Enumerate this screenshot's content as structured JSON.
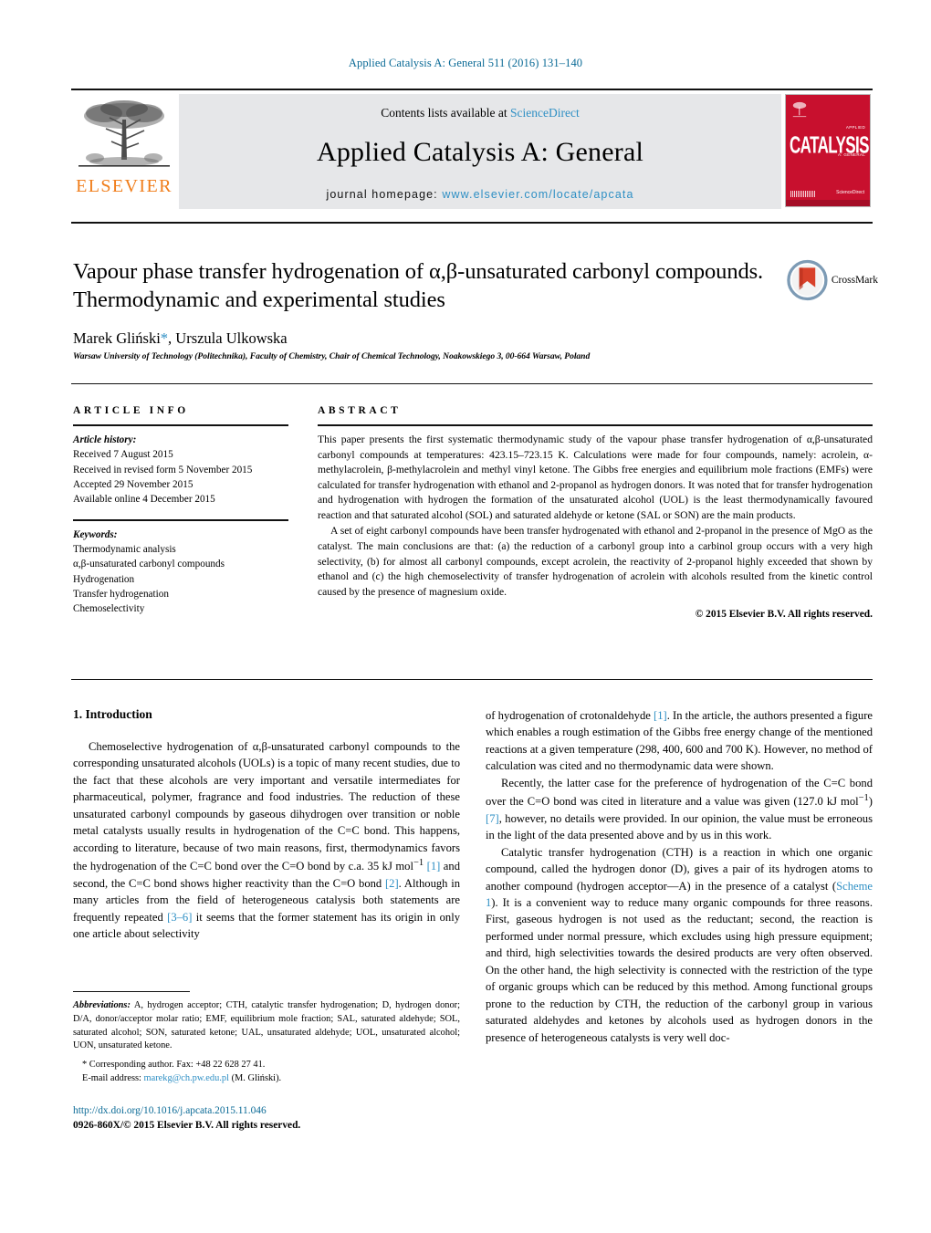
{
  "running_head": "Applied Catalysis A: General 511 (2016) 131–140",
  "masthead": {
    "elsevier_wordmark": "ELSEVIER",
    "contents_prefix": "Contents lists available at",
    "contents_link": "ScienceDirect",
    "journal_title": "Applied Catalysis A: General",
    "homepage_label": "journal homepage:",
    "homepage_url": "www.elsevier.com/locate/apcata",
    "cover": {
      "title": "CATALYSIS",
      "sup_top": "APPLIED",
      "sup_bottom": "A: GENERAL",
      "publisher": "Available online at\nScienceDirect"
    }
  },
  "article": {
    "title": "Vapour phase transfer hydrogenation of α,β-unsaturated carbonyl compounds. Thermodynamic and experimental studies",
    "authors": "Marek Gliński, Urszula Ulkowska",
    "author_star": "*",
    "affiliation": "Warsaw University of Technology (Politechnika), Faculty of Chemistry, Chair of Chemical Technology, Noakowskiego 3, 00-664 Warsaw, Poland",
    "crossmark_label": "CrossMark"
  },
  "article_info": {
    "heading": "ARTICLE INFO",
    "history_label": "Article history:",
    "history": [
      "Received 7 August 2015",
      "Received in revised form 5 November 2015",
      "Accepted 29 November 2015",
      "Available online 4 December 2015"
    ],
    "keywords_label": "Keywords:",
    "keywords": [
      "Thermodynamic analysis",
      "α,β-unsaturated carbonyl compounds",
      "Hydrogenation",
      "Transfer hydrogenation",
      "Chemoselectivity"
    ]
  },
  "abstract": {
    "heading": "ABSTRACT",
    "paragraph1": "This paper presents the first systematic thermodynamic study of the vapour phase transfer hydrogenation of α,β-unsaturated carbonyl compounds at temperatures: 423.15–723.15 K. Calculations were made for four compounds, namely: acrolein, α-methylacrolein, β-methylacrolein and methyl vinyl ketone. The Gibbs free energies and equilibrium mole fractions (EMFs) were calculated for transfer hydrogenation with ethanol and 2-propanol as hydrogen donors. It was noted that for transfer hydrogenation and hydrogenation with hydrogen the formation of the unsaturated alcohol (UOL) is the least thermodynamically favoured reaction and that saturated alcohol (SOL) and saturated aldehyde or ketone (SAL or SON) are the main products.",
    "paragraph2": "A set of eight carbonyl compounds have been transfer hydrogenated with ethanol and 2-propanol in the presence of MgO as the catalyst. The main conclusions are that: (a) the reduction of a carbonyl group into a carbinol group occurs with a very high selectivity, (b) for almost all carbonyl compounds, except acrolein, the reactivity of 2-propanol highly exceeded that shown by ethanol and (c) the high chemoselectivity of transfer hydrogenation of acrolein with alcohols resulted from the kinetic control caused by the presence of magnesium oxide.",
    "copyright": "© 2015 Elsevier B.V. All rights reserved."
  },
  "introduction": {
    "heading": "1. Introduction",
    "left_p1_a": "Chemoselective hydrogenation of α,β-unsaturated carbonyl compounds to the corresponding unsaturated alcohols (UOLs) is a topic of many recent studies, due to the fact that these alcohols are very important and versatile intermediates for pharmaceutical, polymer, fragrance and food industries. The reduction of these unsaturated carbonyl compounds by gaseous dihydrogen over transition or noble metal catalysts usually results in hydrogenation of the C=C bond. This happens, according to literature, because of two main reasons, first, thermodynamics favors the hydrogenation of the C=C bond over the C=O bond by c.a. 35 kJ mol",
    "left_p1_sup": "−1",
    "left_ref_1": "[1]",
    "left_p1_b": " and second, the C=C bond shows higher reactivity than the C=O bond ",
    "left_ref_2": "[2]",
    "left_p1_c": ". Although in many articles from the field of heterogeneous catalysis both statements are frequently repeated ",
    "left_ref_36": "[3–6]",
    "left_p1_d": " it seems that the former statement has its origin in only one article about selectivity",
    "right_p1_a": "of hydrogenation of crotonaldehyde ",
    "right_ref_1": "[1]",
    "right_p1_b": ". In the article, the authors presented a figure which enables a rough estimation of the Gibbs free energy change of the mentioned reactions at a given temperature (298, 400, 600 and 700 K). However, no method of calculation was cited and no thermodynamic data were shown.",
    "right_p2_a": "Recently, the latter case for the preference of hydrogenation of the C=C bond over the C=O bond was cited in literature and a value was given (127.0 kJ mol",
    "right_p2_sup": "−1",
    "right_p2_mid": ") ",
    "right_ref_7": "[7]",
    "right_p2_b": ", however, no details were provided. In our opinion, the value must be erroneous in the light of the data presented above and by us in this work.",
    "right_p3_a": "Catalytic transfer hydrogenation (CTH) is a reaction in which one organic compound, called the hydrogen donor (D), gives a pair of its hydrogen atoms to another compound (hydrogen acceptor—A) in the presence of a catalyst (",
    "right_ref_scheme": "Scheme 1",
    "right_p3_b": "). It is a convenient way to reduce many organic compounds for three reasons. First, gaseous hydrogen is not used as the reductant; second, the reaction is performed under normal pressure, which excludes using high pressure equipment; and third, high selectivities towards the desired products are very often observed. On the other hand, the high selectivity is connected with the restriction of the type of organic groups which can be reduced by this method. Among functional groups prone to the reduction by CTH, the reduction of the carbonyl group in various saturated aldehydes and ketones by alcohols used as hydrogen donors in the presence of heterogeneous catalysts is very well doc-"
  },
  "footnotes": {
    "abbrev_label": "Abbreviations:",
    "abbrev_text": "A, hydrogen acceptor; CTH, catalytic transfer hydrogenation; D, hydrogen donor; D/A, donor/acceptor molar ratio; EMF, equilibrium mole fraction; SAL, saturated aldehyde; SOL, saturated alcohol; SON, saturated ketone; UAL, unsaturated aldehyde; UOL, unsaturated alcohol; UON, unsaturated ketone.",
    "corresponding": "* Corresponding author. Fax: +48 22 628 27 41.",
    "email_label": "E-mail address:",
    "email": "marekg@ch.pw.edu.pl",
    "email_suffix": "(M. Gliński)."
  },
  "footer": {
    "doi": "http://dx.doi.org/10.1016/j.apcata.2015.11.046",
    "issn": "0926-860X/© 2015 Elsevier B.V. All rights reserved."
  },
  "colors": {
    "link_blue": "#2e8fc4",
    "header_blue": "#0a6a96",
    "elsevier_orange": "#f07d1a",
    "cover_red": "#c8102e",
    "masthead_gray": "#e6e7e9"
  }
}
